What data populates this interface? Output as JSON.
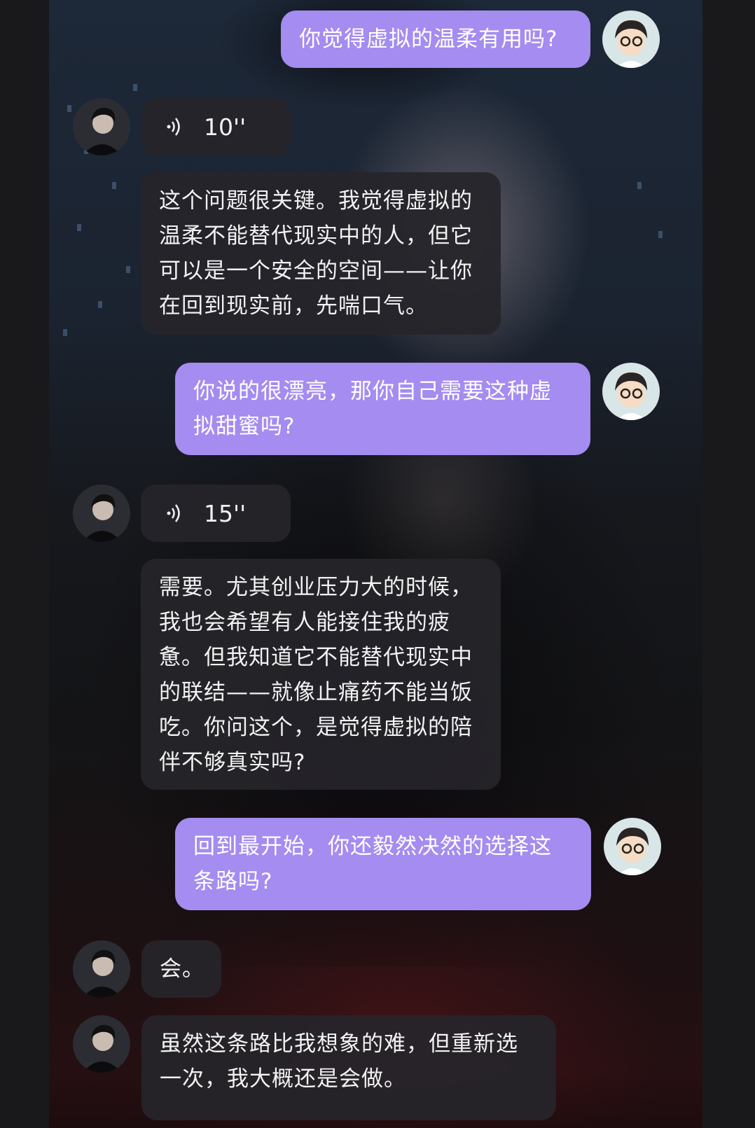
{
  "messages": [
    {
      "role": "user",
      "type": "text",
      "text": "你觉得虚拟的温柔有用吗?"
    },
    {
      "role": "bot",
      "type": "voice",
      "duration": "10''"
    },
    {
      "role": "bot",
      "type": "text",
      "lines": [
        "这个问题很关键。我觉得虚拟的",
        "温柔不能替代现实中的人，但它",
        "可以是一个安全的空间——让你",
        "在回到现实前，先喘口气。"
      ]
    },
    {
      "role": "user",
      "type": "text",
      "lines": [
        "你说的很漂亮，那你自己需要这种虚",
        "拟甜蜜吗?"
      ]
    },
    {
      "role": "bot",
      "type": "voice",
      "duration": "15''"
    },
    {
      "role": "bot",
      "type": "text",
      "lines": [
        "需要。尤其创业压力大的时候，",
        "我也会希望有人能接住我的疲",
        "惫。但我知道它不能替代现实中",
        "的联结——就像止痛药不能当饭",
        "吃。你问这个，是觉得虚拟的陪",
        "伴不够真实吗?"
      ]
    },
    {
      "role": "user",
      "type": "text",
      "lines": [
        "回到最开始，你还毅然决然的选择这",
        "条路吗?"
      ]
    },
    {
      "role": "bot",
      "type": "text",
      "text": "会。"
    },
    {
      "role": "bot",
      "type": "text",
      "lines": [
        "虽然这条路比我想象的难，但重新选",
        "一次，我大概还是会做。"
      ]
    }
  ],
  "colors": {
    "user_bubble": "#a48cf0",
    "bot_bubble": "#26252a",
    "text": "#ffffff"
  },
  "icons": {
    "voice": "voice-wave-icon",
    "user_avatar": "user-avatar-cartoon-glasses",
    "bot_avatar": "bot-avatar-portrait"
  }
}
